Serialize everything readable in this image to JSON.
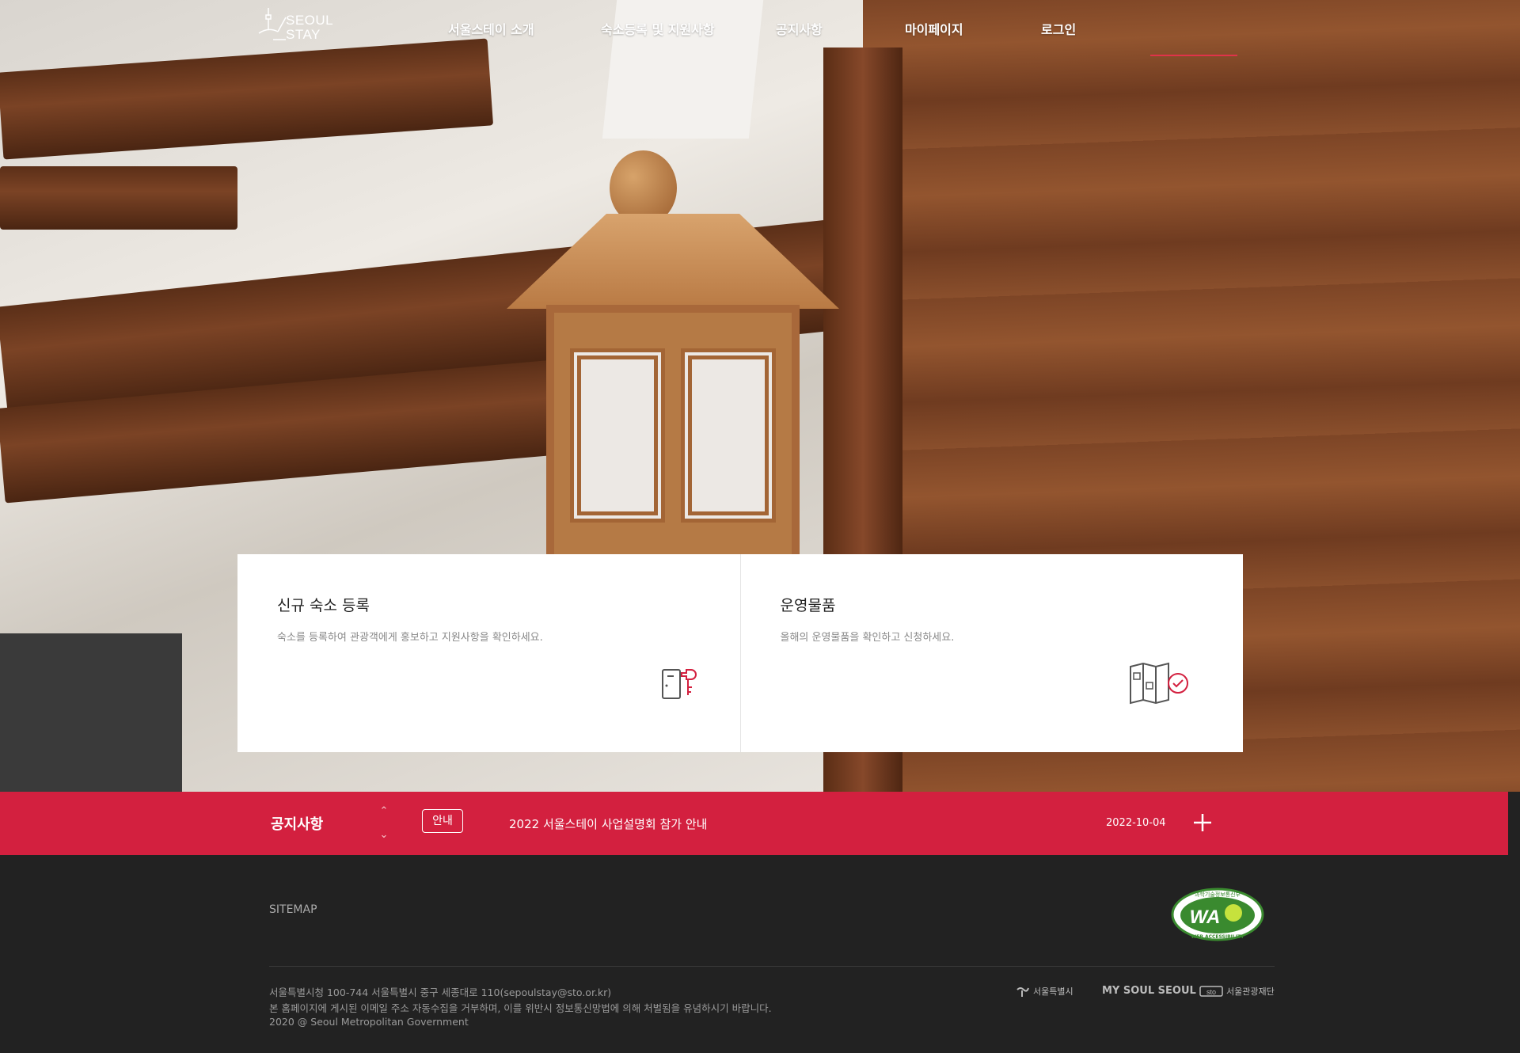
{
  "header": {
    "logo_line1": "SEOUL",
    "logo_line2": "STAY",
    "nav": [
      {
        "label": "서울스테이 소개"
      },
      {
        "label": "숙소등록 및 지원사항"
      },
      {
        "label": "공지사항"
      },
      {
        "label": "마이페이지"
      },
      {
        "label": "로그인"
      }
    ]
  },
  "cards": [
    {
      "title": "신규 숙소 등록",
      "desc": "숙소를 등록하여 관광객에게 홍보하고 지원사항을 확인하세요.",
      "icon": "door-key-icon"
    },
    {
      "title": "운영물품",
      "desc": "올해의 운영물품을 확인하고 신청하세요.",
      "icon": "map-check-icon"
    }
  ],
  "notice": {
    "title": "공지사항",
    "badge": "안내",
    "text": "2022 서울스테이 사업설명회 참가 안내",
    "date": "2022-10-04"
  },
  "footer": {
    "sitemap": "SITEMAP",
    "wa_top": "과학기술정보통신부",
    "wa_mark": "WA",
    "wa_bottom": "WEB ACCESSIBILITY",
    "address_lines": [
      "서울특별시청 100-744 서울특별시 중구 세종대로 110(sepoulstay@sto.or.kr)",
      "본 홈페이지에 게시된 이메일 주소 자동수집을 거부하며, 이를 위반시 정보통신망법에 의해 처벌됨을 유념하시기 바랍니다.",
      "2020 @ Seoul Metropolitan Government"
    ],
    "partners": [
      "서울특별시",
      "MY SOUL SEOUL",
      "서울관광재단"
    ]
  },
  "colors": {
    "accent": "#d3203f",
    "footer_bg": "#222222"
  }
}
